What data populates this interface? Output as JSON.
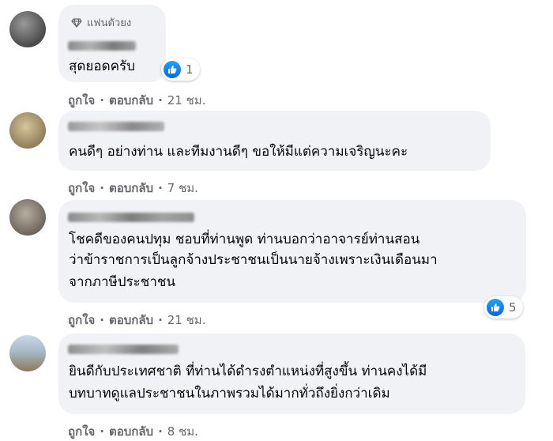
{
  "colors": {
    "bubble": "#f0f2f5",
    "meta": "#65676b",
    "like_blue": "#1877f2"
  },
  "action_labels": {
    "like": "ถูกใจ",
    "reply": "ตอบกลับ",
    "separator": "·"
  },
  "comments": [
    {
      "badge": {
        "icon": "diamond-icon",
        "label": "แฟนตัวยง"
      },
      "text_lines": [
        "สุดยอดครับ"
      ],
      "reactions": {
        "icon": "like-icon",
        "count": "1"
      },
      "time": "21 ชม."
    },
    {
      "text_lines": [
        "คนดีๆ อย่างท่าน และทีมงานดีๆ ขอให้มีแต่ความเจริญนะคะ"
      ],
      "time": "7 ชม."
    },
    {
      "text_lines": [
        "โชคดีของคนปทุม ชอบที่ท่านพูด ท่านบอกว่าอาจารย์ท่านสอน",
        "ว่าข้าราชการเป็นลูกจ้างประชาชนเป็นนายจ้างเพราะเงินเดือนมา",
        "จากภาษีประชาชน"
      ],
      "reactions": {
        "icon": "like-icon",
        "count": "5"
      },
      "time": "21 ชม."
    },
    {
      "text_lines": [
        "ยินดีกับประเทศชาติ ที่ท่านได้ดำรงตำแหน่งที่สูงขึ้น ท่านคงได้มี",
        "บทบาทดูแลประชาชนในภาพรวมได้มากทั่วถึงยิ่งกว่าเดิม"
      ],
      "time": "8 ชม."
    }
  ]
}
